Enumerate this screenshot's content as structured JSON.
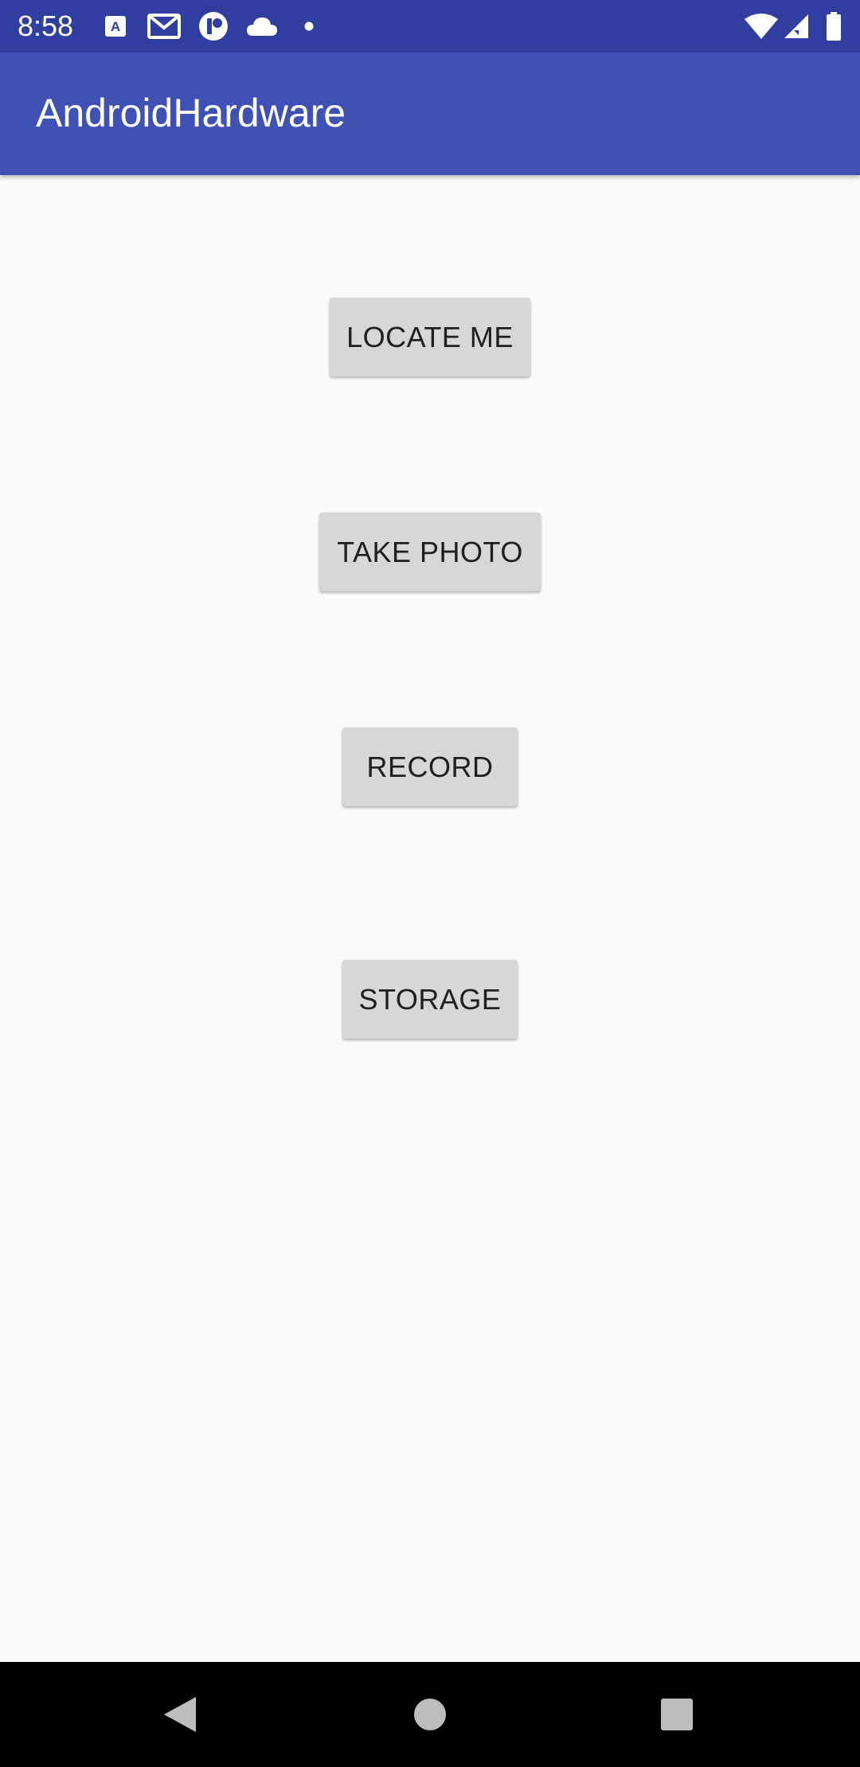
{
  "status_bar": {
    "time": "8:58",
    "color": "#303f9f",
    "icons_left": [
      "translate-icon",
      "gmail-icon",
      "app-notification-icon",
      "cloud-icon",
      "dot-icon"
    ],
    "icons_right": [
      "wifi-icon",
      "signal-icon",
      "battery-icon"
    ]
  },
  "app_bar": {
    "title": "AndroidHardware",
    "color": "#3f51b5"
  },
  "buttons": {
    "locate_me": "LOCATE ME",
    "take_photo": "TAKE PHOTO",
    "record": "RECORD",
    "storage": "STORAGE",
    "color": "#d6d7d7"
  },
  "nav_bar": {
    "icons": [
      "back-icon",
      "home-icon",
      "recents-icon"
    ]
  }
}
